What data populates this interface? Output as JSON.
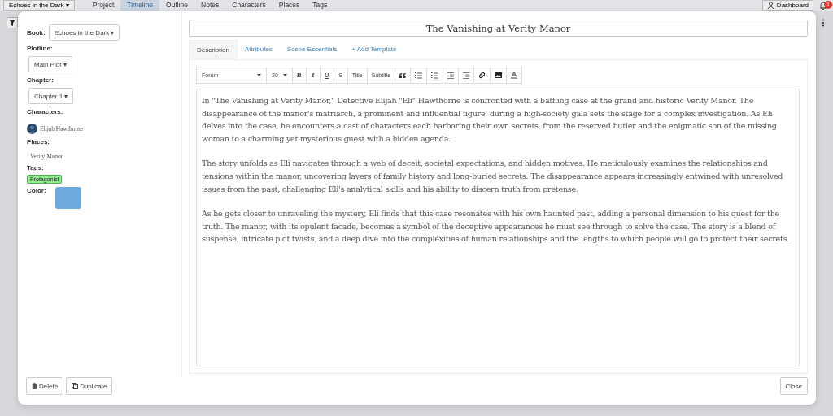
{
  "top_bar": {
    "book_menu": "Echoes in the Dark ▾",
    "nav": [
      {
        "label": "Project",
        "selected": false
      },
      {
        "label": "Timeline",
        "selected": true
      },
      {
        "label": "Outline",
        "selected": false
      },
      {
        "label": "Notes",
        "selected": false
      },
      {
        "label": "Characters",
        "selected": false
      },
      {
        "label": "Places",
        "selected": false
      },
      {
        "label": "Tags",
        "selected": false
      }
    ],
    "dashboard": "Dashboard",
    "notification_count": "1"
  },
  "sidebar": {
    "book_label": "Book:",
    "book": "Echoes in the Dark ▾",
    "plotline_label": "Plotline:",
    "plotline": "Main Plot ▾",
    "chapter_label": "Chapter:",
    "chapter": "Chapter 1 ▾",
    "characters_label": "Characters:",
    "characters": [
      "Elijah Hawthorne"
    ],
    "places_label": "Places:",
    "places": [
      "Verity Manor"
    ],
    "tags_label": "Tags:",
    "tags": [
      {
        "label": "Protagonist",
        "color": "#90ee90"
      }
    ],
    "color_label": "Color:",
    "color": "#6fa8dc"
  },
  "scene": {
    "title": "The Vanishing at Verity Manor",
    "tabs": [
      {
        "label": "Description",
        "selected": true
      },
      {
        "label": "Attributes",
        "selected": false
      },
      {
        "label": "Scene Essentials",
        "selected": false
      },
      {
        "label": "+ Add Template",
        "selected": false
      }
    ],
    "toolbar": {
      "font": "Forum",
      "size": "20",
      "buttons": [
        {
          "kind": "bold",
          "label": "B"
        },
        {
          "kind": "italic",
          "label": "I"
        },
        {
          "kind": "underline",
          "label": "U"
        },
        {
          "kind": "strike",
          "label": "S"
        },
        {
          "kind": "text",
          "label": "Title"
        },
        {
          "kind": "text",
          "label": "Subtitle"
        },
        {
          "kind": "quote"
        },
        {
          "kind": "ordered-list"
        },
        {
          "kind": "bullet-list"
        },
        {
          "kind": "outdent"
        },
        {
          "kind": "indent"
        },
        {
          "kind": "link"
        },
        {
          "kind": "image"
        },
        {
          "kind": "text-color"
        }
      ]
    },
    "paragraphs": [
      "In \"The Vanishing at Verity Manor,\" Detective Elijah \"Eli\" Hawthorne is confronted with a baffling case at the grand and historic Verity Manor. The disappearance of the manor's matriarch, a prominent and influential figure, during a high-society gala sets the stage for a complex investigation. As Eli delves into the case, he encounters a cast of characters each harboring their own secrets, from the reserved butler and the enigmatic son of the missing woman to a charming yet mysterious guest with a hidden agenda.",
      "The story unfolds as Eli navigates through a web of deceit, societal expectations, and hidden motives. He meticulously examines the relationships and tensions within the manor, uncovering layers of family history and long-buried secrets. The disappearance appears increasingly entwined with unresolved issues from the past, challenging Eli's analytical skills and his ability to discern truth from pretense.",
      "As he gets closer to unraveling the mystery, Eli finds that this case resonates with his own haunted past, adding a personal dimension to his quest for the truth. The manor, with its opulent facade, becomes a symbol of the deceptive appearances he must see through to solve the case. The story is a blend of suspense, intricate plot twists, and a deep dive into the complexities of human relationships and the lengths to which people will go to protect their secrets."
    ]
  },
  "footer": {
    "delete": "Delete",
    "duplicate": "Duplicate",
    "close": "Close"
  }
}
